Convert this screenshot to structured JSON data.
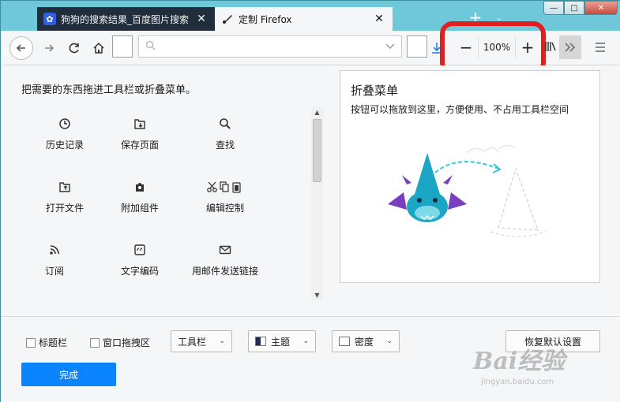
{
  "tabs": [
    {
      "title": "狗狗的搜索结果_百度图片搜索",
      "favicon": "baidu-paw-icon",
      "active": false
    },
    {
      "title": "定制 Firefox",
      "favicon": "paintbrush-icon",
      "active": true
    }
  ],
  "window_controls": {
    "minimize": "—",
    "maximize": "□",
    "close": "✕"
  },
  "navbar": {
    "url_value": "",
    "zoom_level": "100%",
    "zoom_out": "−",
    "zoom_in": "+"
  },
  "palette": {
    "title": "把需要的东西拖进工具栏或折叠菜单。",
    "items": [
      {
        "label": "历史记录",
        "icon": "history-icon"
      },
      {
        "label": "保存页面",
        "icon": "save-page-icon"
      },
      {
        "label": "查找",
        "icon": "find-icon"
      },
      {
        "label": "打开文件",
        "icon": "open-file-icon"
      },
      {
        "label": "附加组件",
        "icon": "addons-icon"
      },
      {
        "label": "编辑控制",
        "icon": "edit-controls-icon"
      },
      {
        "label": "订阅",
        "icon": "feed-icon"
      },
      {
        "label": "文字编码",
        "icon": "text-encoding-icon"
      },
      {
        "label": "用邮件发送链接",
        "icon": "email-link-icon"
      }
    ]
  },
  "overflow_panel": {
    "title": "折叠菜单",
    "description": "按钮可以拖放到这里，方便使用、不占用工具栏空间"
  },
  "bottombar": {
    "titlebar_checkbox": "标题栏",
    "drag_space_checkbox": "窗口拖拽区",
    "toolbars_dropdown": "工具栏",
    "themes_dropdown": "主题",
    "density_dropdown": "密度",
    "restore_defaults": "恢复默认设置",
    "done": "完成"
  },
  "watermark": {
    "main": "Bai经验",
    "sub": "jingyan.baidu.com"
  },
  "colors": {
    "accent": "#0a84ff",
    "highlight": "#e02020",
    "frame": "#6fc8da"
  }
}
